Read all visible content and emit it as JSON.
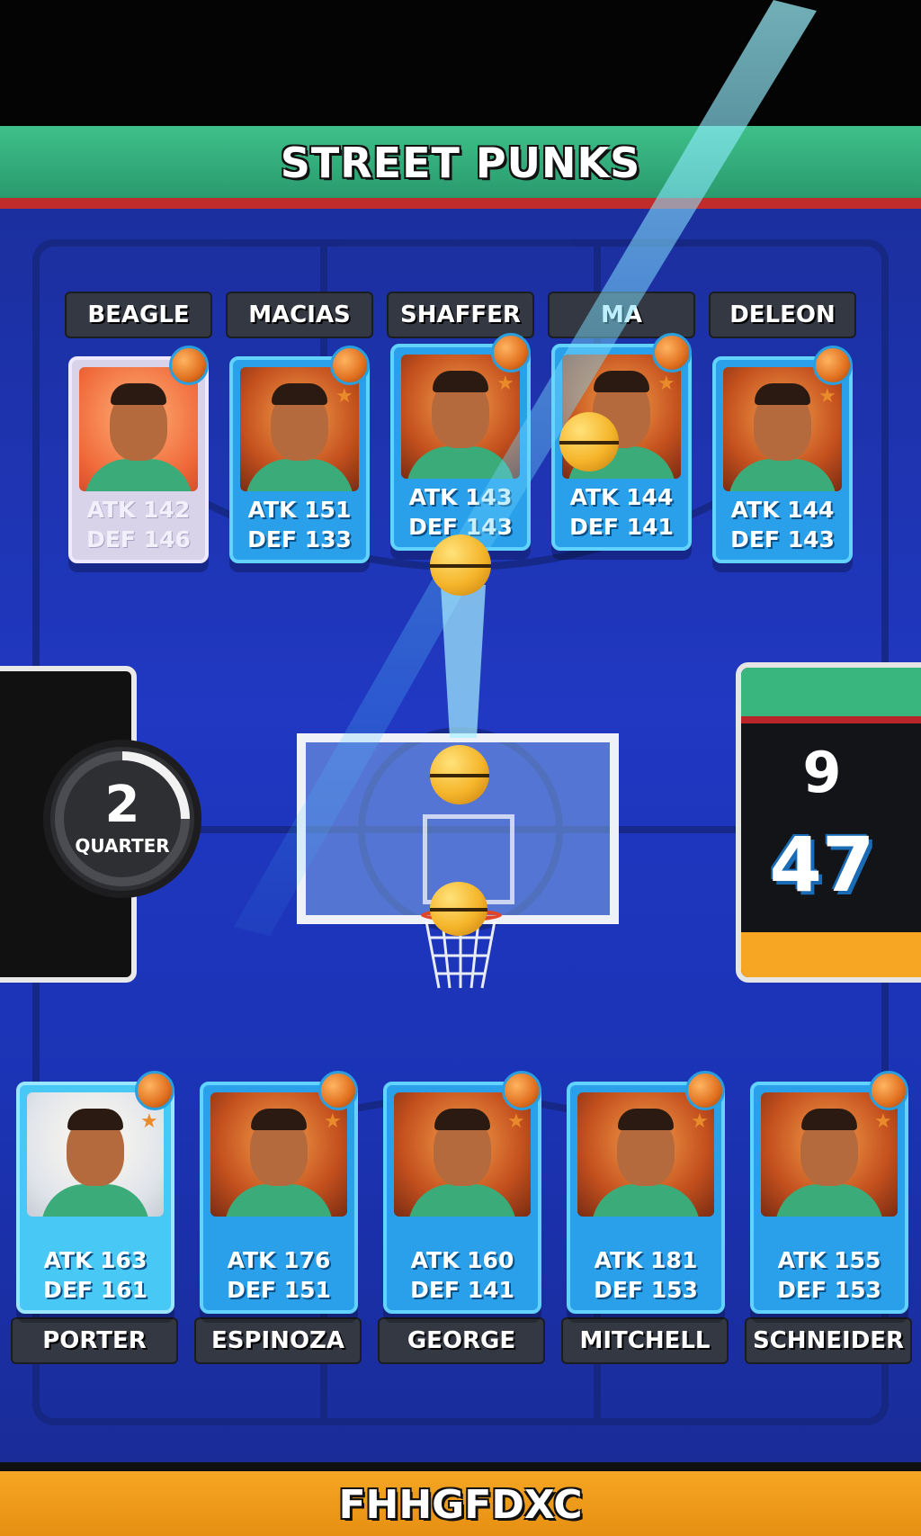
{
  "game": {
    "opponent_team": "STREET PUNKS",
    "home_team": "FHHGFDXC"
  },
  "opponent_players": [
    {
      "name": "BEAGLE",
      "atk": "ATK 142",
      "def": "DEF 146",
      "state": "faded"
    },
    {
      "name": "MACIAS",
      "atk": "ATK 151",
      "def": "DEF 133",
      "state": "normal"
    },
    {
      "name": "SHAFFER",
      "atk": "ATK 143",
      "def": "DEF 143",
      "state": "normal"
    },
    {
      "name": "MA",
      "atk": "ATK 144",
      "def": "DEF 141",
      "state": "normal"
    },
    {
      "name": "DELEON",
      "atk": "ATK 144",
      "def": "DEF 143",
      "state": "normal"
    }
  ],
  "home_players": [
    {
      "name": "PORTER",
      "atk": "ATK 163",
      "def": "DEF 161",
      "state": "light"
    },
    {
      "name": "ESPINOZA",
      "atk": "ATK 176",
      "def": "DEF 151",
      "state": "normal"
    },
    {
      "name": "GEORGE",
      "atk": "ATK 160",
      "def": "DEF 141",
      "state": "normal"
    },
    {
      "name": "MITCHELL",
      "atk": "ATK 181",
      "def": "DEF 153",
      "state": "normal"
    },
    {
      "name": "SCHNEIDER",
      "atk": "ATK 155",
      "def": "DEF 153",
      "state": "normal"
    }
  ],
  "quarter": {
    "number": "2",
    "label": "QUARTER",
    "progress_fraction": 0.25
  },
  "score": {
    "opponent": "9",
    "home": "47"
  },
  "colors": {
    "opponent_green": "#3ec08a",
    "home_orange": "#f6a623",
    "court_blue": "#2038c2",
    "card_blue": "#2aa0ea"
  },
  "icons": {
    "card_badge": "basketball-coin-icon",
    "rank": "star-icon"
  }
}
